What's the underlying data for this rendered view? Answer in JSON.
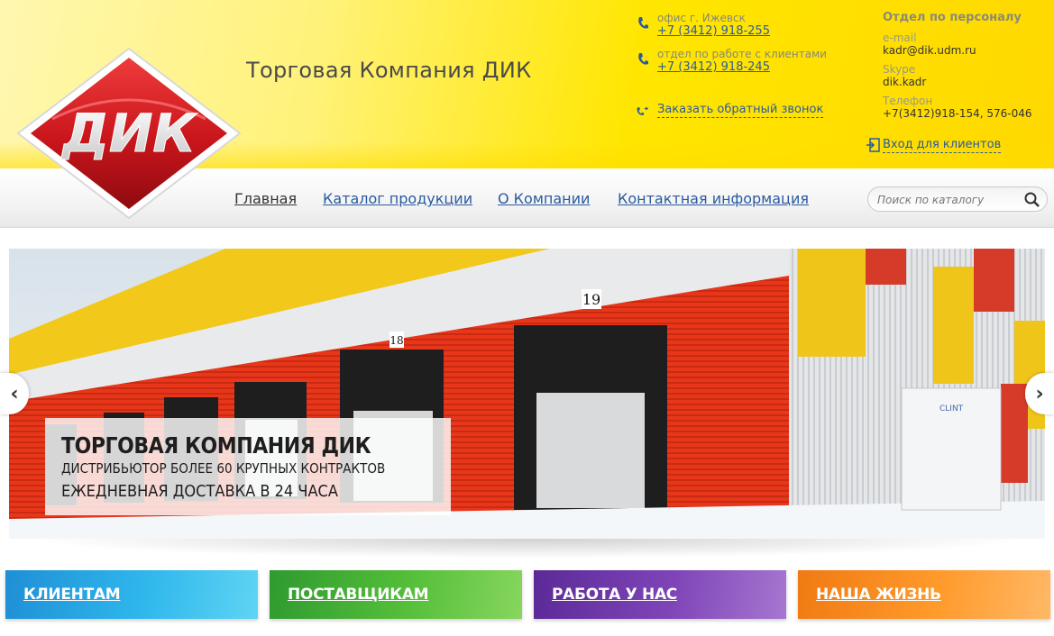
{
  "header": {
    "company_title": "Торговая Компания ДИК",
    "logo_text": "ДИК",
    "office": {
      "label": "офис г. Ижевск",
      "phone": "+7 (3412) 918-255"
    },
    "clients_dept": {
      "label": "отдел по работе с клиентами",
      "phone": "+7 (3412) 918-245"
    },
    "callback_label": "Заказать обратный звонок",
    "hr": {
      "title": "Отдел по персоналу",
      "email_label": "e-mail",
      "email": "kadr@dik.udm.ru",
      "skype_label": "Skype",
      "skype": "dik.kadr",
      "phone_label": "Телефон",
      "phone": "+7(3412)918-154, 576-046"
    },
    "login_label": "Вход для клиентов"
  },
  "nav": {
    "items": [
      {
        "label": "Главная"
      },
      {
        "label": "Каталог продукции"
      },
      {
        "label": "О Компании"
      },
      {
        "label": "Контактная информация"
      }
    ],
    "search_placeholder": "Поиск по каталогу"
  },
  "banner": {
    "line1": "ТОРГОВАЯ КОМПАНИЯ ДИК",
    "line2": "ДИСТРИБЬЮТОР БОЛЕЕ 60 КРУПНЫХ КОНТРАКТОВ",
    "line3": "ЕЖЕДНЕВНАЯ ДОСТАВКА В 24 ЧАСА",
    "door_numbers": [
      "19",
      "18"
    ],
    "unit_brand": "CLINT"
  },
  "tiles": [
    {
      "label": "КЛИЕНТАМ"
    },
    {
      "label": "ПОСТАВЩИКАМ"
    },
    {
      "label": "РАБОТА У НАС"
    },
    {
      "label": "НАША ЖИЗНЬ"
    }
  ],
  "colors": {
    "header_yellow": "#ffe600",
    "link_blue": "#2a5aa0",
    "logo_red": "#c8151b",
    "tile_blue": "#2fb7ec",
    "tile_green": "#55bf3a",
    "tile_purple": "#7f45b8",
    "tile_orange": "#ff9a2b"
  }
}
